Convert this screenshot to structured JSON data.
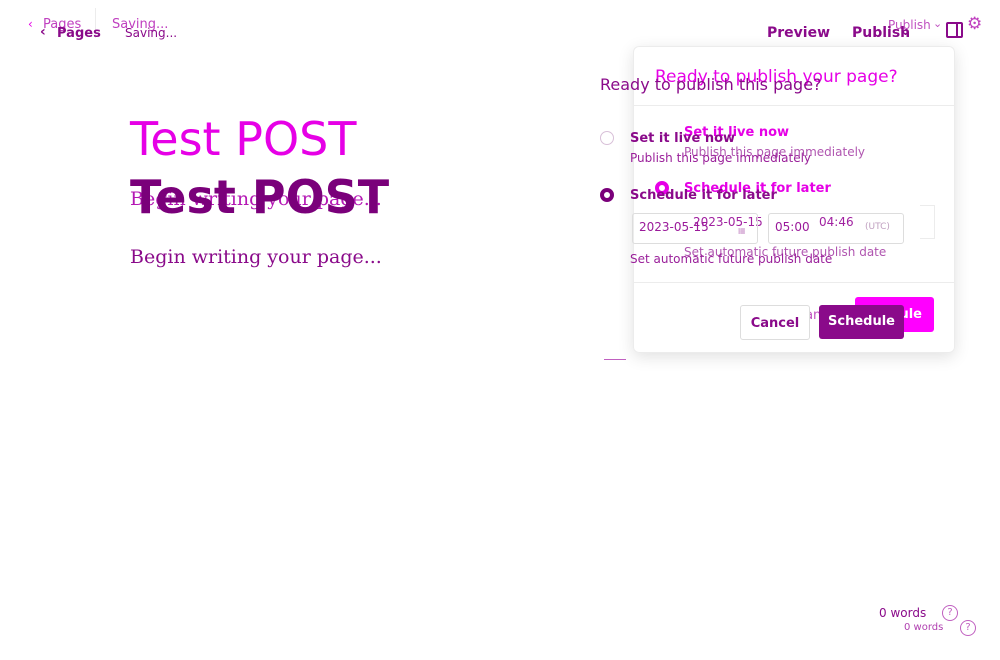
{
  "header": {
    "back_label": "Pages",
    "status": "Saving...",
    "preview_label": "Preview",
    "publish_label": "Publish"
  },
  "editor": {
    "title": "Test POST",
    "placeholder": "Begin writing your page..."
  },
  "publish_panel": {
    "heading_back": "Ready to publish your page?",
    "heading_front": "Ready to publish this page?",
    "option_now_title": "Set it live now",
    "option_now_sub": "Publish this page immediately",
    "option_later_title": "Schedule it for later",
    "option_later_sub": "Set automatic future publish date",
    "date_value_front": "2023-05-15",
    "time_value_front": "05:00",
    "date_value_back": "2023-05-15",
    "time_value_back": "04:46",
    "timezone": "(UTC)",
    "cancel_label": "Cancel",
    "cancel_label_back": "Can",
    "schedule_label": "Schedule",
    "schedule_label_back": "dule",
    "selected_option": "later"
  },
  "footer": {
    "word_count": "0 words",
    "help_glyph": "?"
  },
  "colors": {
    "accent": "#e600e6",
    "accent_dark": "#7a007a"
  },
  "icons": {
    "back": "chevron-left-icon",
    "publish_caret": "chevron-down-icon",
    "sidebar": "sidebar-toggle-icon",
    "settings": "gear-icon",
    "help": "help-icon",
    "calendar": "calendar-icon"
  }
}
